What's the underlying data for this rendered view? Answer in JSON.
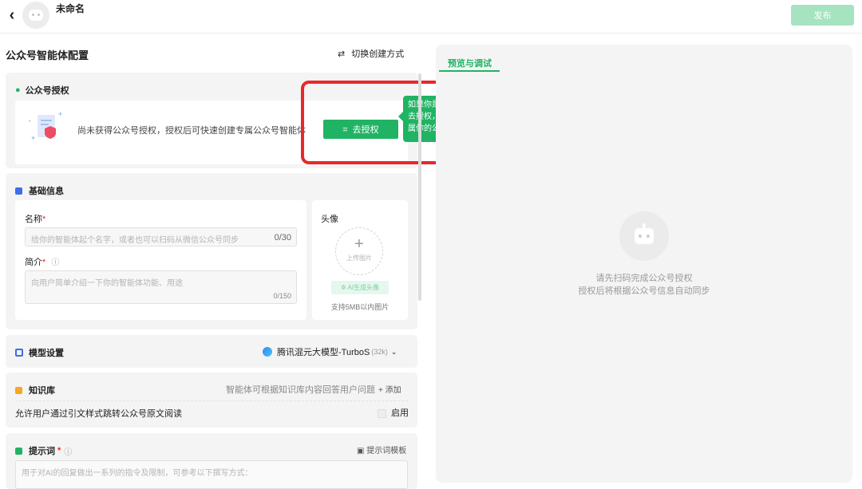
{
  "header": {
    "back_icon": "‹",
    "title": "未命名",
    "publish_label": "发布"
  },
  "config": {
    "title": "公众号智能体配置",
    "switch_label": "切换创建方式"
  },
  "auth": {
    "title": "公众号授权",
    "message": "尚未获得公众号授权，授权后可快速创建专属公众号智能体",
    "button_label": "去授权",
    "tooltip_line1": "如果你是微信公众号主，可以点击",
    "tooltip_line2": "去授权，扫码授权后，快速创建专",
    "tooltip_line3": "属你的公众号智能体哦"
  },
  "basic": {
    "title": "基础信息",
    "name_label": "名称",
    "name_placeholder": "给你的智能体起个名字，或者也可以扫码从微信公众号同步",
    "name_count": "0/30",
    "intro_label": "简介",
    "intro_placeholder": "向用户简单介绍一下你的智能体功能、用途",
    "intro_count": "0/150",
    "avatar_label": "头像",
    "upload_label": "上传图片",
    "ai_avatar_label": "AI生成头像",
    "avatar_hint": "支持5MB以内图片"
  },
  "model": {
    "title": "模型设置",
    "model_name": "腾讯混元大模型-TurboS",
    "model_ctx": "(32k)"
  },
  "knowledge": {
    "title": "知识库",
    "hint": "智能体可根据知识库内容回答用户问题",
    "add_label": "添加",
    "allow_label": "允许用户通过引文样式跳转公众号原文阅读",
    "enable_label": "启用"
  },
  "prompt": {
    "title": "提示词",
    "template_label": "提示词模板",
    "placeholder": "用于对AI的回复做出一系列的指令及限制，可参考以下撰写方式："
  },
  "preview": {
    "tab_label": "预览与调试",
    "line1": "请先扫码完成公众号授权",
    "line2": "授权后将根据公众号信息自动同步"
  },
  "colors": {
    "accent": "#20b364",
    "highlight": "#e8282b"
  }
}
